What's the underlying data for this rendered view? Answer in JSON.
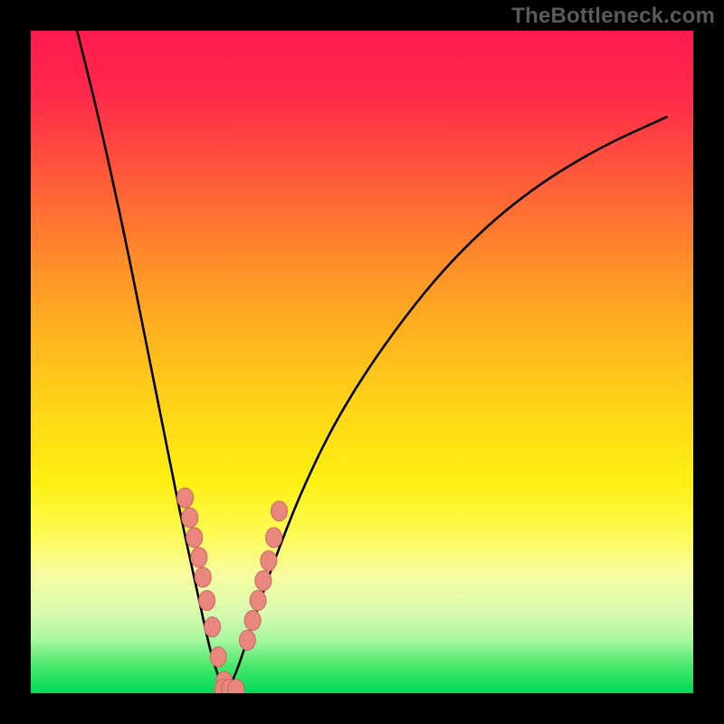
{
  "watermark": "TheBottleneck.com",
  "chart_data": {
    "type": "line",
    "title": "",
    "xlabel": "",
    "ylabel": "",
    "xlim": [
      0,
      100
    ],
    "ylim": [
      0,
      100
    ],
    "grid": false,
    "legend": "none",
    "series": [
      {
        "name": "bottleneck-curve-left",
        "x": [
          7,
          10,
          14,
          18,
          21,
          23,
          25,
          26.5,
          27.5,
          28.5,
          29.5
        ],
        "y": [
          100,
          88,
          70,
          50,
          35,
          25,
          16,
          9,
          5,
          2,
          0
        ]
      },
      {
        "name": "bottleneck-curve-right",
        "x": [
          29.5,
          31,
          33,
          36,
          41,
          47,
          55,
          64,
          74,
          85,
          96
        ],
        "y": [
          0,
          3,
          9,
          18,
          31,
          43,
          55,
          66,
          75,
          82,
          87
        ]
      },
      {
        "name": "marker-beads-left",
        "x": [
          23.3,
          24.0,
          24.7,
          25.4,
          26.0,
          26.6,
          27.4,
          28.3,
          29.2
        ],
        "y": [
          29.5,
          26.5,
          23.5,
          20.5,
          17.5,
          14.0,
          10.0,
          5.5,
          1.8
        ]
      },
      {
        "name": "marker-beads-bottom",
        "x": [
          29.0,
          30.0,
          31.0
        ],
        "y": [
          0.6,
          0.6,
          0.6
        ]
      },
      {
        "name": "marker-beads-right",
        "x": [
          32.7,
          33.5,
          34.3,
          35.1,
          35.9,
          36.7,
          37.5
        ],
        "y": [
          8.0,
          11.0,
          14.0,
          17.0,
          20.0,
          23.5,
          27.5
        ]
      }
    ],
    "annotations": [],
    "colors": {
      "curve": "#000000",
      "bead_fill": "#e9877f",
      "bead_stroke": "#c96a5f",
      "gradient_top": "#ff1a4f",
      "gradient_bottom": "#00d85a"
    }
  }
}
